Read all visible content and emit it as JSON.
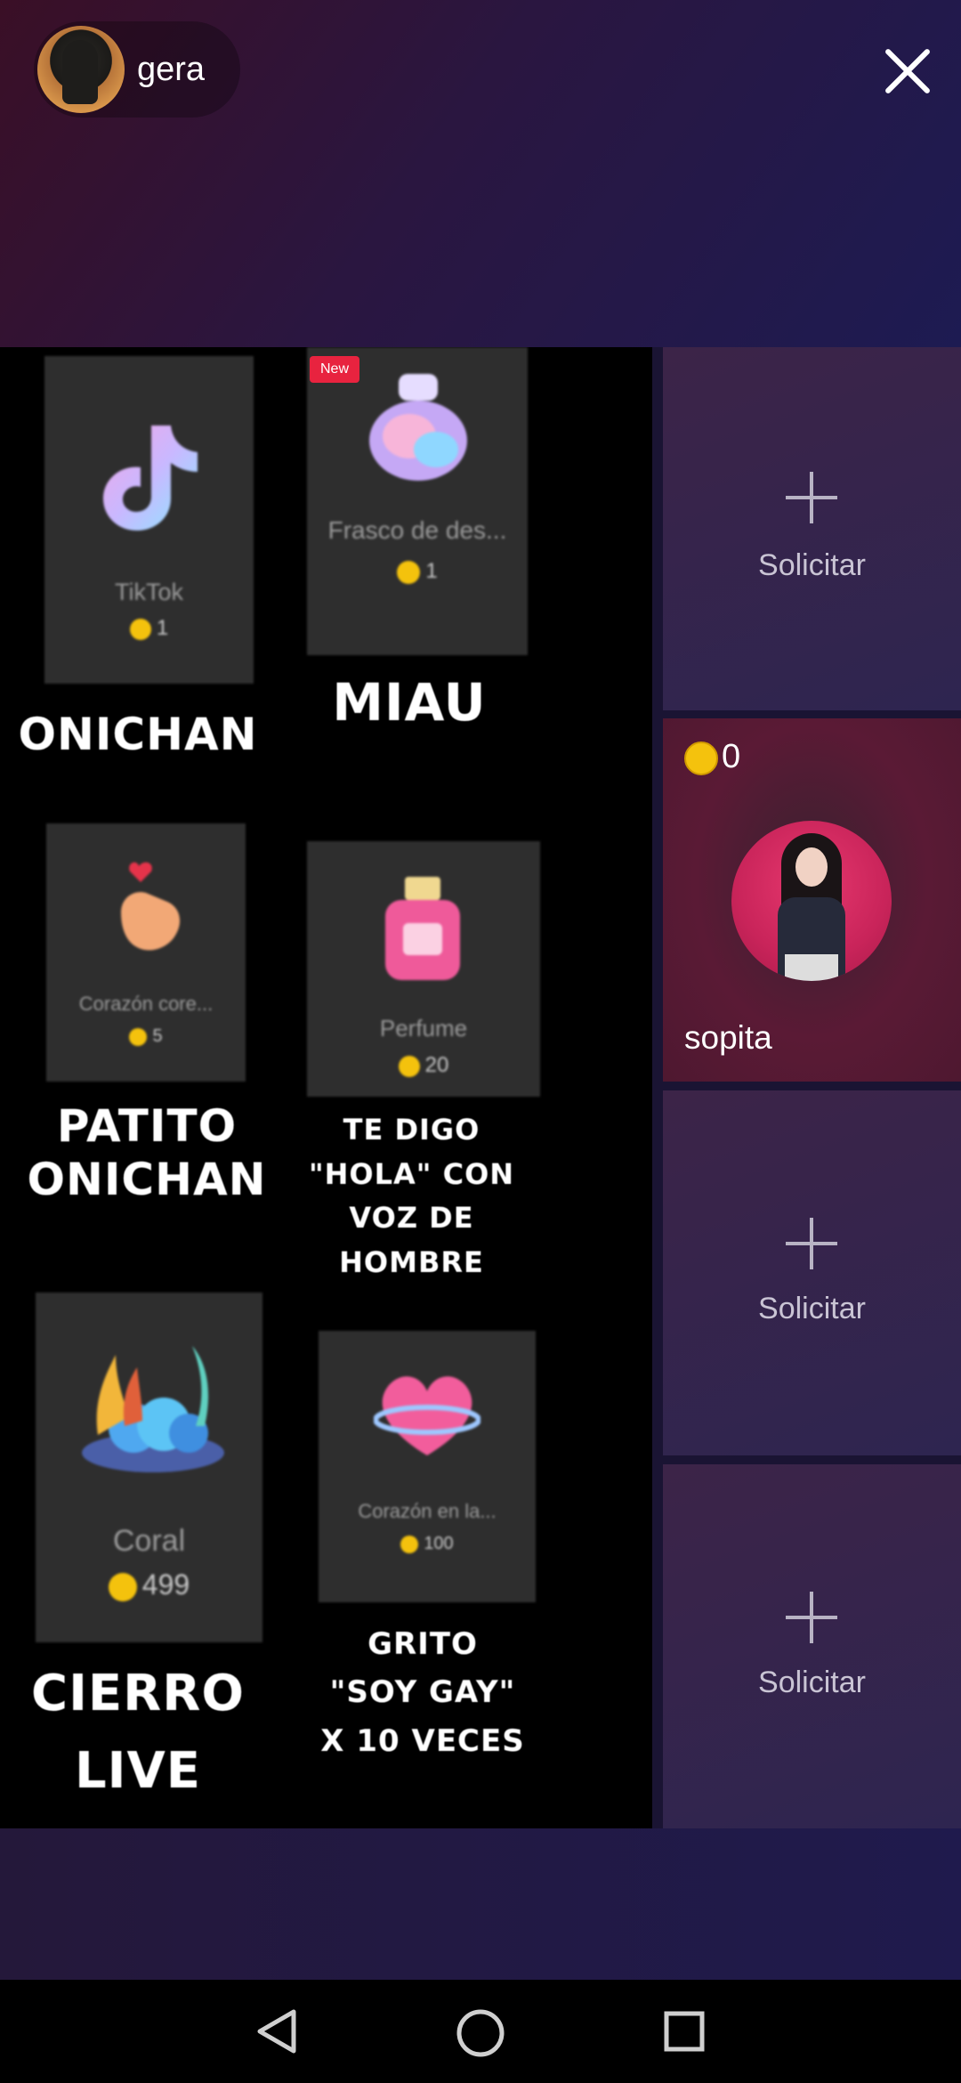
{
  "header": {
    "host_name": "gera",
    "close_icon": "close-icon"
  },
  "menu": {
    "new_badge": "New",
    "gifts": [
      {
        "name": "TikTok",
        "price": "1",
        "caption": "ONICHAN"
      },
      {
        "name": "Frasco de des...",
        "price": "1",
        "caption": "MIAU"
      },
      {
        "name": "Corazón core...",
        "price": "5",
        "caption_lines": [
          "PATITO",
          "ONICHAN"
        ]
      },
      {
        "name": "Perfume",
        "price": "20",
        "caption_lines": [
          "TE DIGO",
          "\"HOLA\" CON",
          "VOZ DE",
          "HOMBRE"
        ]
      },
      {
        "name": "Coral",
        "price": "499",
        "caption_lines": [
          "CIERRO",
          "LIVE"
        ]
      },
      {
        "name": "Corazón en la...",
        "price": "100",
        "caption_lines": [
          "GRITO",
          "\"SOY GAY\"",
          "X 10 VECES"
        ]
      }
    ]
  },
  "slots": {
    "request_label": "Solicitar",
    "guest": {
      "coins": "0",
      "name": "sopita"
    }
  },
  "nav": {
    "back_icon": "back-triangle-icon",
    "home_icon": "home-circle-icon",
    "recent_icon": "recent-square-icon"
  },
  "colors": {
    "accent_coin": "#f4c20d",
    "new_badge": "#e8233f"
  }
}
